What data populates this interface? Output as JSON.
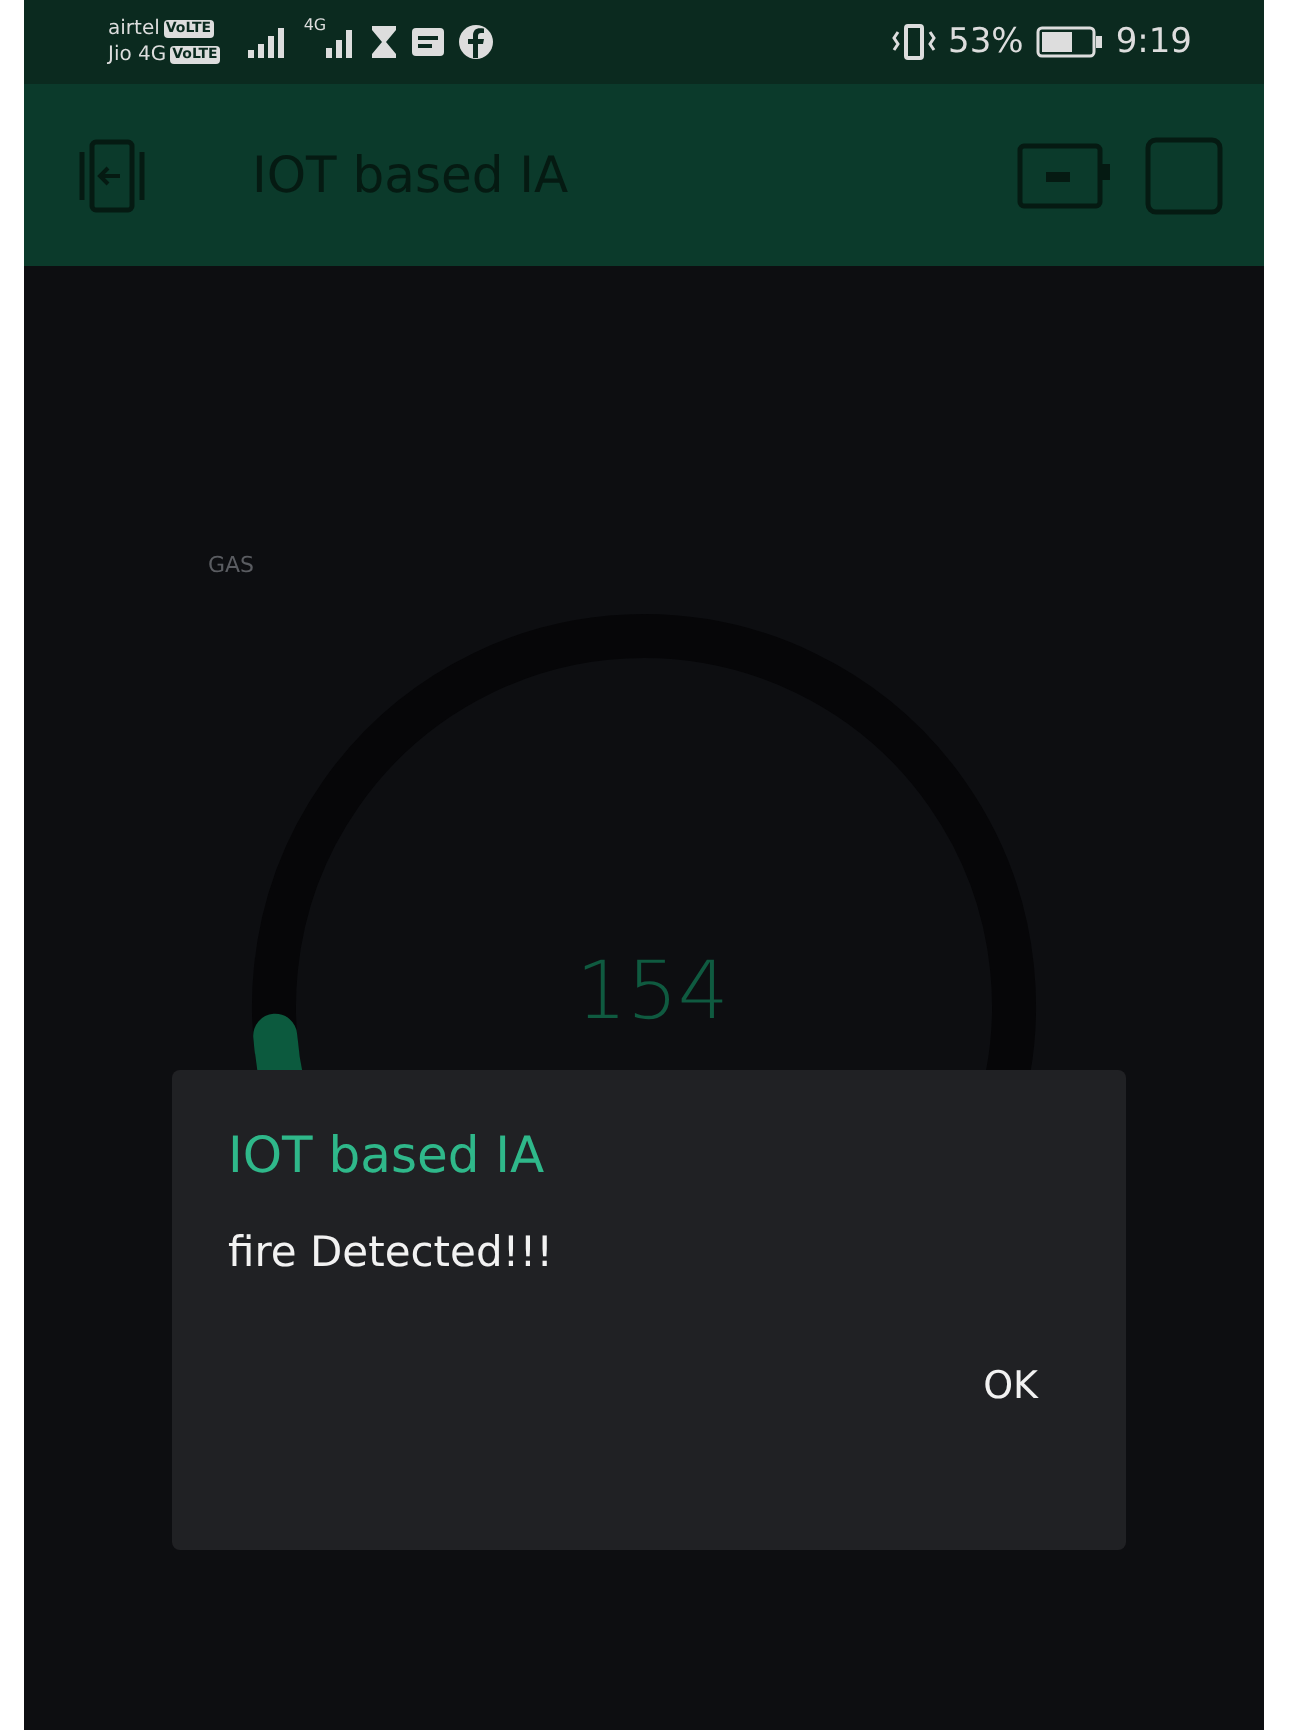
{
  "status_bar": {
    "carrier_1": "airtel",
    "carrier_1_badge": "VoLTE",
    "carrier_2": "Jio 4G",
    "carrier_2_badge": "VoLTE",
    "network": "4G",
    "battery_percent": "53%",
    "time": "9:19"
  },
  "app_bar": {
    "title": "IOT based IA"
  },
  "gauge": {
    "label": "GAS",
    "value": "154"
  },
  "dialog": {
    "title": "IOT based IA",
    "message": "fire Detected!!!",
    "buttons": [
      "OK"
    ]
  }
}
